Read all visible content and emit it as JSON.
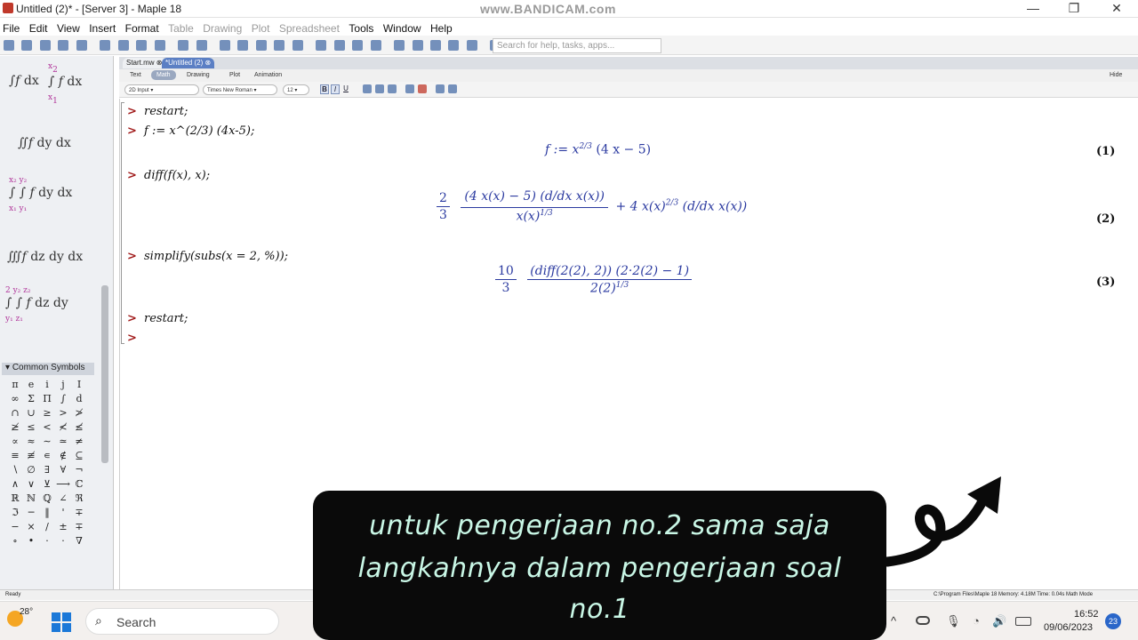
{
  "window": {
    "title": "Untitled (2)* - [Server 3] - Maple 18",
    "watermark": "www.BANDICAM.com"
  },
  "menu": [
    {
      "label": "File",
      "enabled": true
    },
    {
      "label": "Edit",
      "enabled": true
    },
    {
      "label": "View",
      "enabled": true
    },
    {
      "label": "Insert",
      "enabled": true
    },
    {
      "label": "Format",
      "enabled": true
    },
    {
      "label": "Table",
      "enabled": false
    },
    {
      "label": "Drawing",
      "enabled": false
    },
    {
      "label": "Plot",
      "enabled": false
    },
    {
      "label": "Spreadsheet",
      "enabled": false
    },
    {
      "label": "Tools",
      "enabled": true
    },
    {
      "label": "Window",
      "enabled": true
    },
    {
      "label": "Help",
      "enabled": true
    }
  ],
  "search": {
    "placeholder": "Search for help, tasks, apps..."
  },
  "tabs": [
    {
      "label": "Start.mw",
      "active": false
    },
    {
      "label": "*Untitled (2)",
      "active": true
    }
  ],
  "modebar": {
    "items": [
      "Text",
      "Math",
      "Drawing",
      "Plot",
      "Animation"
    ],
    "hide": "Hide"
  },
  "format": {
    "input_mode": "2D Input",
    "font": "Times New Roman",
    "size": "12"
  },
  "palette": {
    "common_symbols_header": "Common Symbols",
    "symbols": [
      "π",
      "e",
      "i",
      "j",
      "I",
      "∞",
      "Σ",
      "Π",
      "∫",
      "d",
      "∩",
      "∪",
      "≥",
      ">",
      "≯",
      "≱",
      "≤",
      "<",
      "≮",
      "≰",
      "∝",
      "≈",
      "∼",
      "≃",
      "≠",
      "≡",
      "≢",
      "∊",
      "∉",
      "⊆",
      "∖",
      "∅",
      "∃",
      "∀",
      "¬",
      "∧",
      "∨",
      "⊻",
      "⟶",
      "ℂ",
      "ℝ",
      "ℕ",
      "ℚ",
      "∠",
      "ℜ",
      "ℑ",
      "─",
      "‖",
      "'",
      "∓",
      "−",
      "×",
      "/",
      "±",
      "∓",
      "∘",
      "•",
      "·",
      "·",
      "∇"
    ]
  },
  "worksheet": {
    "cmd1": "restart;",
    "cmd2": "f := x^(2/3) (4x-5);",
    "out1": "f := x",
    "out1_exp": "2/3",
    "out1_tail": "(4 x − 5)",
    "label1": "(1)",
    "cmd3": "diff(f(x), x);",
    "out2_coef_num": "2",
    "out2_coef_den": "3",
    "out2_num": "(4 x(x) − 5) (d/dx x(x))",
    "out2_den": "x(x)",
    "out2_den_exp": "1/3",
    "out2_tail": "+ 4 x(x)",
    "out2_tail_exp": "2/3",
    "out2_tail2": "(d/dx x(x))",
    "label2": "(2)",
    "cmd4": "simplify(subs(x = 2, %));",
    "out3_coef_num": "10",
    "out3_coef_den": "3",
    "out3_num": "(diff(2(2), 2)) (2·2(2) − 1)",
    "out3_den": "2(2)",
    "out3_den_exp": "1/3",
    "label3": "(3)",
    "cmd5": "restart;"
  },
  "statusbar": {
    "left": "Ready",
    "right": "C:\\Program Files\\Maple 18   Memory: 4.18M   Time: 0.04s   Math Mode"
  },
  "taskbar": {
    "weather": "28°",
    "search_label": "Search",
    "time": "16:52",
    "date": "09/06/2023",
    "badge": "23"
  },
  "overlay": {
    "line1": "untuk pengerjaan no.2 sama saja",
    "line2": "langkahnya dalam pengerjaan soal",
    "line3": "no.1"
  }
}
